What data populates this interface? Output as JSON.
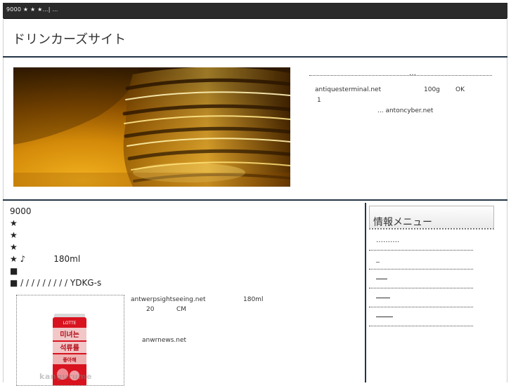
{
  "topbar": {
    "text": "9000 ★ ★ ★…| …"
  },
  "site": {
    "title": "ドリンカーズサイト"
  },
  "hero": {
    "ellipsis": "…",
    "link1": "antiquesterminal.net",
    "amount": "100g",
    "ok": "OK",
    "num": "1",
    "link2": "... antoncyber.net"
  },
  "main": {
    "lines": [
      "9000",
      "★",
      "★",
      "★",
      "★ ♪",
      "■",
      "■ /  /  /  / / /  /  /  / YDKG-s"
    ],
    "volume": "180ml"
  },
  "product": {
    "watermark": "kangurume",
    "can_colors": {
      "red": "#d8131f",
      "light": "#f6e8e6",
      "top": "#d8d8d8"
    },
    "can_texts": {
      "brand": "LOTTE",
      "line1": "미녀는",
      "line2": "석류를",
      "line3": "좋아해"
    },
    "desc_link1": "antwerpsightseeing.net",
    "desc_volume": "180ml",
    "desc_num": "20",
    "desc_cm": "CM",
    "desc_link2": "anwrnews.net"
  },
  "sidebar": {
    "header": "情報メニュー",
    "items": [
      {
        "label": "……….",
        "style": "text"
      },
      {
        "label": "_",
        "style": "text"
      },
      {
        "label": "",
        "style": "line",
        "width": 16
      },
      {
        "label": "",
        "style": "line",
        "width": 20
      },
      {
        "label": "",
        "style": "line",
        "width": 24
      }
    ]
  },
  "colors": {
    "topbar": "#2a2a2a",
    "rule": "#243447",
    "accent_amber": "#c27a00"
  }
}
